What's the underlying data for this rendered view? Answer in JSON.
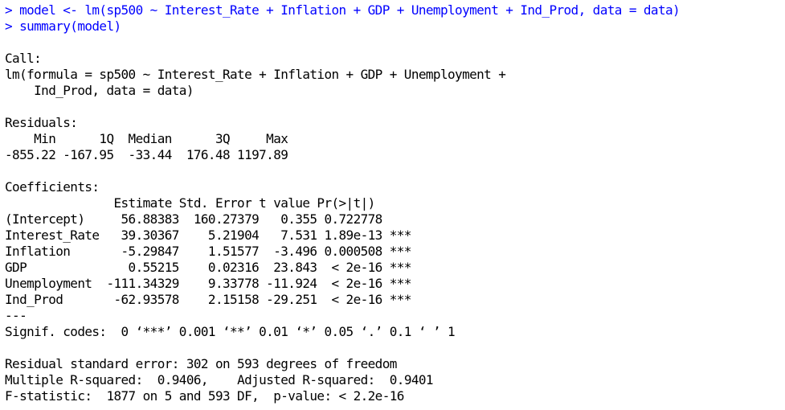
{
  "console": {
    "input_lines": [
      "> model <- lm(sp500 ~ Interest_Rate + Inflation + GDP + Unemployment + Ind_Prod, data = data)",
      "> summary(model)"
    ],
    "output_lines": [
      "Call:",
      "lm(formula = sp500 ~ Interest_Rate + Inflation + GDP + Unemployment + ",
      "    Ind_Prod, data = data)",
      "Residuals:",
      "    Min      1Q  Median      3Q     Max ",
      "-855.22 -167.95  -33.44  176.48 1197.89 ",
      "Coefficients:",
      "               Estimate Std. Error t value Pr(>|t|)    ",
      "(Intercept)     56.88383  160.27379   0.355 0.722778    ",
      "Interest_Rate   39.30367    5.21904   7.531 1.89e-13 ***",
      "Inflation       -5.29847    1.51577  -3.496 0.000508 ***",
      "GDP              0.55215    0.02316  23.843  < 2e-16 ***",
      "Unemployment  -111.34329    9.33778 -11.924  < 2e-16 ***",
      "Ind_Prod       -62.93578    2.15158 -29.251  < 2e-16 ***",
      "---",
      "Signif. codes:  0 ‘***’ 0.001 ‘**’ 0.01 ‘*’ 0.05 ‘.’ 0.1 ‘ ’ 1",
      "Residual standard error: 302 on 593 degrees of freedom",
      "Multiple R-squared:  0.9406,\tAdjusted R-squared:  0.9401 ",
      "F-statistic:  1877 on 5 and 593 DF,  p-value: < 2.2e-16"
    ]
  }
}
